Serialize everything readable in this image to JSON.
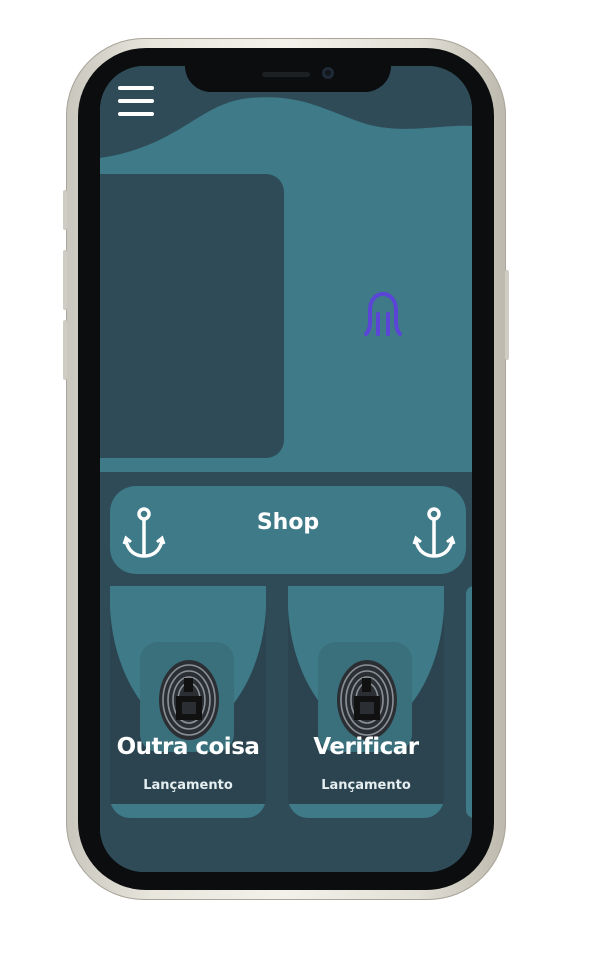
{
  "app": {
    "menu_icon": "hamburger-menu-icon",
    "hero_icon": "octopus-icon",
    "colors": {
      "primary": "#3e7a87",
      "dark": "#2f4b58",
      "accent": "#5b45d6"
    }
  },
  "shop": {
    "label": "Shop",
    "icon": "anchor-icon"
  },
  "cards": [
    {
      "title": "Outra coisa",
      "subtitle": "Lançamento",
      "icon": "fingerprint-icon"
    },
    {
      "title": "Verificar",
      "subtitle": "Lançamento",
      "icon": "fingerprint-icon"
    }
  ]
}
